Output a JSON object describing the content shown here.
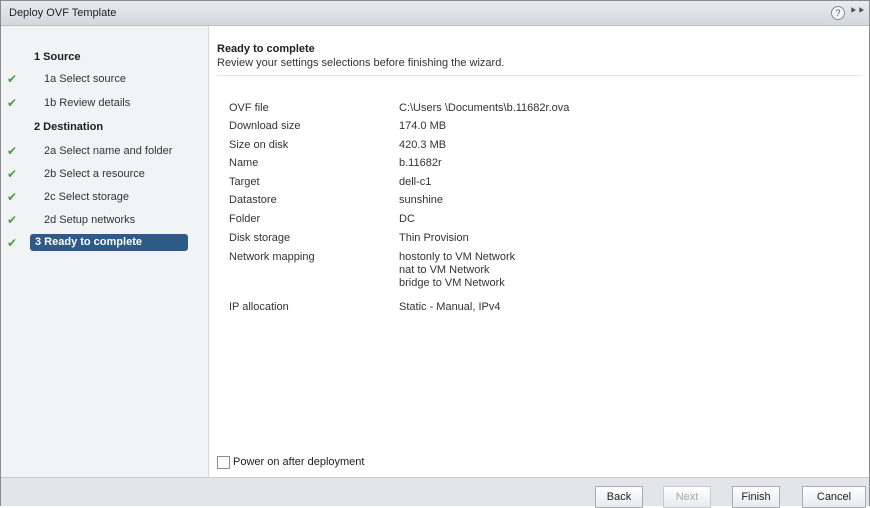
{
  "window": {
    "title": "Deploy OVF Template",
    "help_glyph": "?",
    "expand_glyph": "⯈⯈"
  },
  "sidebar": {
    "steps": [
      {
        "label": "1  Source",
        "done": false,
        "type": "header"
      },
      {
        "label": "1a  Select source",
        "done": true,
        "type": "sub"
      },
      {
        "label": "1b  Review details",
        "done": true,
        "type": "sub"
      },
      {
        "label": "2  Destination",
        "done": false,
        "type": "header"
      },
      {
        "label": "2a  Select name and folder",
        "done": true,
        "type": "sub"
      },
      {
        "label": "2b  Select a resource",
        "done": true,
        "type": "sub"
      },
      {
        "label": "2c  Select storage",
        "done": true,
        "type": "sub"
      },
      {
        "label": "2d  Setup networks",
        "done": true,
        "type": "sub"
      },
      {
        "label": "3  Ready to complete",
        "done": true,
        "type": "active"
      }
    ]
  },
  "main": {
    "title": "Ready to complete",
    "subtitle": "Review your settings selections before finishing the wizard.",
    "details": [
      {
        "key": "OVF file",
        "value": "C:\\Users      \\Documents\\b.11682r.ova"
      },
      {
        "key": "Download size",
        "value": "174.0 MB"
      },
      {
        "key": "Size on disk",
        "value": "420.3 MB"
      },
      {
        "key": "Name",
        "value": "b.11682r"
      },
      {
        "key": "Target",
        "value": "dell-c1"
      },
      {
        "key": "Datastore",
        "value": "sunshine"
      },
      {
        "key": "Folder",
        "value": "DC"
      },
      {
        "key": "Disk storage",
        "value": "Thin Provision"
      },
      {
        "key": "Network mapping",
        "value_lines": [
          "hostonly to VM Network",
          "nat to VM Network",
          "bridge to VM Network"
        ]
      },
      {
        "key": "IP allocation",
        "value": "Static - Manual, IPv4"
      }
    ],
    "power_on_label": "Power on after deployment",
    "power_on_checked": false
  },
  "footer": {
    "back": "Back",
    "next": "Next",
    "finish": "Finish",
    "cancel": "Cancel"
  },
  "icons": {
    "check": "check-icon",
    "help": "help-icon",
    "expand": "expand-icon"
  },
  "colors": {
    "active_step": "#2d5a87",
    "check": "#43a047"
  }
}
